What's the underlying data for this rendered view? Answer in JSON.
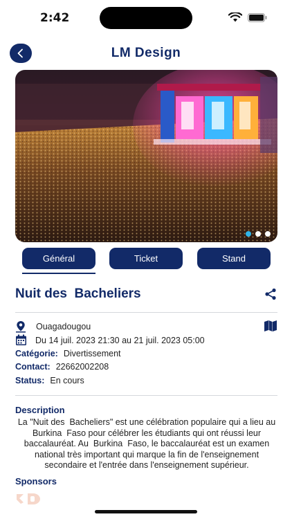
{
  "status_bar": {
    "time": "2:42"
  },
  "header": {
    "title": "LM Design"
  },
  "banner": {
    "slides": 3,
    "active_slide": 1,
    "accent": "#2fb4e8"
  },
  "tabs": [
    {
      "label": "Général",
      "selected": true
    },
    {
      "label": "Ticket",
      "selected": false
    },
    {
      "label": "Stand",
      "selected": false
    }
  ],
  "event": {
    "title": "Nuit des  Bacheliers",
    "location": "Ouagadougou",
    "dates": "Du 14 juil. 2023 21:30 au 21 juil. 2023 05:00",
    "category_label": "Catégorie:",
    "category": "Divertissement",
    "contact_label": "Contact:",
    "contact": "22662002208",
    "status_label": "Status:",
    "status": "En cours"
  },
  "description": {
    "title": "Description",
    "text": "La \"Nuit des  Bacheliers\" est une célébration populaire qui a lieu au  Burkina  Faso pour célébrer les étudiants qui ont réussi leur baccalauréat. Au  Burkina  Faso, le baccalauréat est un examen national très important qui marque la fin de l'enseignement secondaire et l'entrée dans l'enseignement supérieur."
  },
  "sponsors": {
    "title": "Sponsors"
  },
  "colors": {
    "primary": "#122a68",
    "divider": "#d5d7dc"
  }
}
